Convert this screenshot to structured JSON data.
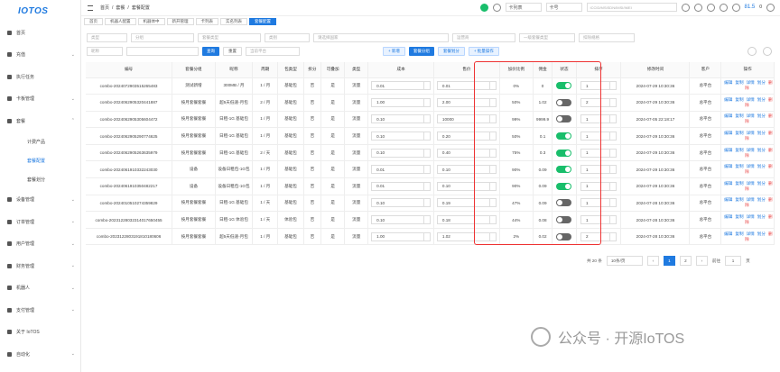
{
  "logo": "IOTOS",
  "sidebar": [
    {
      "label": "首页",
      "arrow": ""
    },
    {
      "label": "充值",
      "arrow": "⌄"
    },
    {
      "label": "执行任务",
      "arrow": ""
    },
    {
      "label": "卡板管理",
      "arrow": "⌄"
    },
    {
      "label": "套餐",
      "arrow": "⌃"
    }
  ],
  "submenu": [
    "计费产品",
    "套餐配置",
    "套餐划分"
  ],
  "sidebar2": [
    {
      "label": "设备管理",
      "arrow": "⌄"
    },
    {
      "label": "订单管理",
      "arrow": "⌄"
    },
    {
      "label": "用户管理",
      "arrow": "⌄"
    },
    {
      "label": "财务管理",
      "arrow": "⌄"
    },
    {
      "label": "机器人",
      "arrow": "⌄"
    },
    {
      "label": "支付管理",
      "arrow": "⌄"
    },
    {
      "label": "关于 IoTOS",
      "arrow": ""
    },
    {
      "label": "自动化",
      "arrow": "⌄"
    }
  ],
  "breadcrumb": [
    "首页",
    "/",
    "套餐",
    "/",
    "套餐配置"
  ],
  "topbar": {
    "card_sel": "卡列表",
    "card_type": "卡号",
    "search_placeholder": "ICCID/MSISDN/IMSI/IMEI",
    "zoom": "81.5",
    "lang": "0"
  },
  "tabs": [
    "首页",
    "机器人配置",
    "机器体中",
    "新开管理",
    "卡列表",
    "实名列表",
    "套餐配置"
  ],
  "filters1": [
    "类型",
    "分组",
    "套餐类型",
    "类别",
    "请选择国家",
    "运营商",
    "一级套餐类型",
    "扣除规格"
  ],
  "filters2": {
    "name_placeholder": "昵称",
    "search": "查询",
    "reset": "重置",
    "owner": "当前平台",
    "add": "+ 新增",
    "group": "套餐分组",
    "divide": "套餐划分",
    "batch": "+ 批量操作"
  },
  "columns": [
    "编号",
    "套餐分组",
    "昵称",
    "周期",
    "包类型",
    "拆分",
    "可叠加",
    "类型",
    "成本",
    "售价",
    "加价比例",
    "佣金",
    "状态",
    "排序",
    "修改时间",
    "客户",
    "操作"
  ],
  "rows": [
    {
      "id": "combo-2024072903515265483",
      "group": "测试新增",
      "name": "300MB / 月",
      "period": "1 / 月",
      "pkg": "基础包",
      "split": "否",
      "stack": "是",
      "type": "流量",
      "cost": "0.01",
      "price": "0.01",
      "ratio": "0%",
      "comm": "0",
      "on": true,
      "sort": "1",
      "time": "2024-07-29 10:30:36",
      "cust": "总平台"
    },
    {
      "id": "combo-2024062905320441887",
      "group": "按月套餐套餐",
      "name": "超5天低速-月包",
      "period": "2 / 月",
      "pkg": "基础包",
      "split": "否",
      "stack": "是",
      "type": "流量",
      "cost": "1.00",
      "price": "2.00",
      "ratio": "50%",
      "comm": "1.02",
      "on": false,
      "sort": "2",
      "time": "2024-07-29 10:30:36",
      "cust": "总平台"
    },
    {
      "id": "combo-2024062905305604472",
      "group": "按月套餐套餐",
      "name": "日租-1G 基础包",
      "period": "1 / 月",
      "pkg": "基础包",
      "split": "否",
      "stack": "是",
      "type": "流量",
      "cost": "0.10",
      "price": "10000",
      "ratio": "99%",
      "comm": "9999.9",
      "on": false,
      "sort": "1",
      "time": "2024-07-05 22:18:17",
      "cust": "总平台"
    },
    {
      "id": "combo-2024062905290774625",
      "group": "按月套餐套餐",
      "name": "日租-1G 基础包",
      "period": "1 / 月",
      "pkg": "基础包",
      "split": "否",
      "stack": "是",
      "type": "流量",
      "cost": "0.10",
      "price": "0.20",
      "ratio": "50%",
      "comm": "0.1",
      "on": true,
      "sort": "1",
      "time": "2024-07-29 10:30:36",
      "cust": "总平台"
    },
    {
      "id": "combo-2024062905263635979",
      "group": "按月套餐套餐",
      "name": "日租-1G 基础包",
      "period": "2 / 天",
      "pkg": "基础包",
      "split": "否",
      "stack": "是",
      "type": "流量",
      "cost": "0.10",
      "price": "0.40",
      "ratio": "75%",
      "comm": "0.3",
      "on": true,
      "sort": "1",
      "time": "2024-07-29 10:30:36",
      "cust": "总平台"
    },
    {
      "id": "combo-2024061910332243030",
      "group": "设备",
      "name": "设备日租包-1G包",
      "period": "1 / 月",
      "pkg": "基础包",
      "split": "否",
      "stack": "是",
      "type": "流量",
      "cost": "0.01",
      "price": "0.10",
      "ratio": "90%",
      "comm": "0.09",
      "on": true,
      "sort": "1",
      "time": "2024-07-29 10:30:36",
      "cust": "总平台"
    },
    {
      "id": "combo-2024061910350482217",
      "group": "设备",
      "name": "设备日租包-1G包",
      "period": "1 / 月",
      "pkg": "基础包",
      "split": "否",
      "stack": "是",
      "type": "流量",
      "cost": "0.01",
      "price": "0.10",
      "ratio": "90%",
      "comm": "0.09",
      "on": true,
      "sort": "1",
      "time": "2024-07-29 10:30:36",
      "cust": "总平台"
    },
    {
      "id": "combo-2024010510274359829",
      "group": "按月套餐套餐",
      "name": "日租-1G 基础包",
      "period": "1 / 天",
      "pkg": "基础包",
      "split": "否",
      "stack": "是",
      "type": "流量",
      "cost": "0.10",
      "price": "0.19",
      "ratio": "47%",
      "comm": "0.09",
      "on": false,
      "sort": "1",
      "time": "2024-07-28 10:30:36",
      "cust": "总平台"
    },
    {
      "id": "combo-20231228032314017650455",
      "group": "按月套餐套餐",
      "name": "日租-1G 体验包",
      "period": "1 / 天",
      "pkg": "体验包",
      "split": "否",
      "stack": "是",
      "type": "流量",
      "cost": "0.10",
      "price": "0.18",
      "ratio": "44%",
      "comm": "0.08",
      "on": false,
      "sort": "1",
      "time": "2024-07-28 10:30:36",
      "cust": "总平台"
    },
    {
      "id": "combo-2023122803191810180606",
      "group": "按月套餐套餐",
      "name": "超5天低速-月包",
      "period": "1 / 月",
      "pkg": "基础包",
      "split": "否",
      "stack": "是",
      "type": "流量",
      "cost": "1.00",
      "price": "1.02",
      "ratio": "2%",
      "comm": "0.02",
      "on": false,
      "sort": "2",
      "time": "2024-07-28 10:30:36",
      "cust": "总平台"
    }
  ],
  "ops": [
    "编辑",
    "复制",
    "详情",
    "划分",
    "删除"
  ],
  "pager": {
    "total": "共 20 条",
    "size": "10条/页",
    "page1": "1",
    "page2": "2",
    "goto": "前往",
    "current": "1",
    "unit": "页"
  },
  "watermark": "公众号 · 开源IoTOS"
}
